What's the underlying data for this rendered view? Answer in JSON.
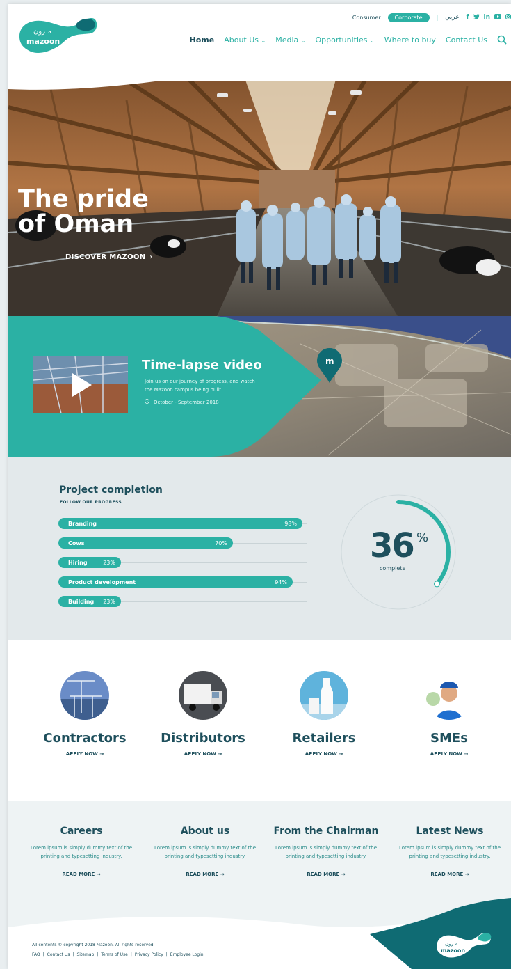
{
  "brand": {
    "name": "mazoon",
    "name_ar": "مـزون"
  },
  "topbar": {
    "consumer": "Consumer",
    "corporate": "Corporate",
    "separator": "|",
    "arabic": "عربي",
    "social": [
      "f",
      "t",
      "in",
      "yt",
      "ig"
    ]
  },
  "nav": {
    "items": [
      "Home",
      "About Us",
      "Media",
      "Opportunities",
      "Where to buy",
      "Contact Us"
    ]
  },
  "hero": {
    "title_line1": "The pride",
    "title_line2": "of Oman",
    "cta": "DISCOVER MAZOON"
  },
  "video": {
    "title": "Time-lapse video",
    "description": "Join us on our journey of progress, and watch the Mazoon campus being built.",
    "date": "October - September 2018",
    "map_marker": "m"
  },
  "progress": {
    "title": "Project completion",
    "subtitle": "FOLLOW OUR PROGRESS",
    "bars": [
      {
        "label": "Branding",
        "value": 98,
        "display": "98%"
      },
      {
        "label": "Cows",
        "value": 70,
        "display": "70%"
      },
      {
        "label": "Hiring",
        "value": 23,
        "display": "23%"
      },
      {
        "label": "Product development",
        "value": 94,
        "display": "94%"
      },
      {
        "label": "Building",
        "value": 23,
        "display": "23%"
      }
    ],
    "overall": {
      "value": "36",
      "unit": "%",
      "label": "complete",
      "fraction": 0.36
    }
  },
  "partners": [
    {
      "name": "Contractors",
      "cta": "APPLY NOW →"
    },
    {
      "name": "Distributors",
      "cta": "APPLY NOW →"
    },
    {
      "name": "Retailers",
      "cta": "APPLY NOW →"
    },
    {
      "name": "SMEs",
      "cta": "APPLY NOW →"
    }
  ],
  "info": [
    {
      "title": "Careers",
      "text": "Lorem ipsum is simply dummy text of the printing and typesetting industry.",
      "cta": "READ MORE →"
    },
    {
      "title": "About us",
      "text": "Lorem ipsum is simply dummy text of the printing and typesetting industry.",
      "cta": "READ MORE →"
    },
    {
      "title": "From the Chairman",
      "text": "Lorem ipsum is simply dummy text of the printing and typesetting industry.",
      "cta": "READ MORE →"
    },
    {
      "title": "Latest News",
      "text": "Lorem ipsum is simply dummy text of the printing and typesetting industry.",
      "cta": "READ MORE →"
    }
  ],
  "footer": {
    "copyright": "All contents © copyright 2018 Mazoon. All rights reserved.",
    "links": [
      "FAQ",
      "Contact Us",
      "Sitemap",
      "Terms of Use",
      "Privacy Policy",
      "Employee Login"
    ]
  },
  "colors": {
    "teal": "#2bb1a4",
    "navy": "#1e4f5c",
    "dark_teal": "#0f6b73"
  }
}
